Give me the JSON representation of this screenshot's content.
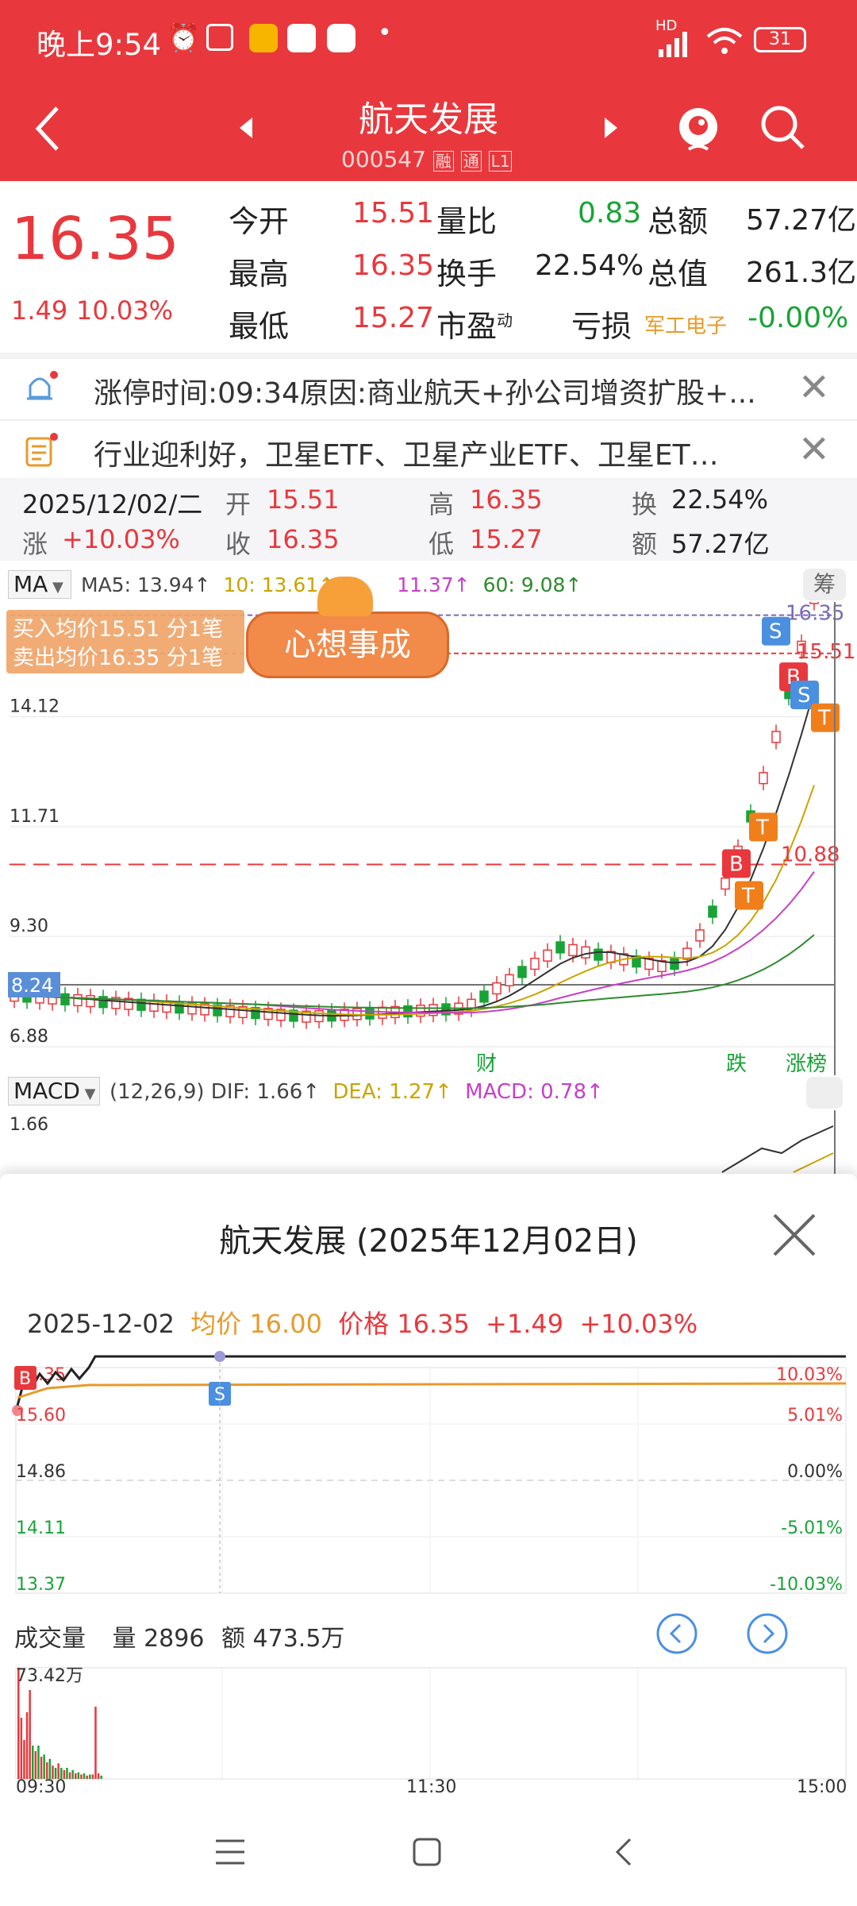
{
  "status": {
    "time": "晚上9:54",
    "signal": "HD",
    "battery": "31"
  },
  "nav": {
    "title": "航天发展",
    "code": "000547",
    "tag1": "融",
    "tag2": "通",
    "tag3": "L1"
  },
  "quote": {
    "price": "16.35",
    "change": "1.49",
    "change_pct": "10.03%",
    "open_label": "今开",
    "open": "15.51",
    "high_label": "最高",
    "high": "16.35",
    "low_label": "最低",
    "low": "15.27",
    "vol_ratio_label": "量比",
    "vol_ratio": "0.83",
    "turnover_label": "换手",
    "turnover": "22.54%",
    "pe_label": "市盈",
    "pe_sup": "动",
    "pe": "亏损",
    "amount_label": "总额",
    "amount": "57.27亿",
    "mktcap_label": "总值",
    "mktcap": "261.3亿",
    "sector": "军工电子",
    "sector_pct": "-0.00%"
  },
  "notices": [
    {
      "text": "涨停时间:09:34原因:商业航天+孙公司增资扩股+..."
    },
    {
      "text": "行业迎利好，卫星ETF、卫星产业ETF、卫星ET…"
    }
  ],
  "dayinfo": {
    "date": "2025/12/02/二",
    "open_l": "开",
    "open": "15.51",
    "high_l": "高",
    "high": "16.35",
    "turn_l": "换",
    "turn": "22.54%",
    "chg_l": "涨",
    "chg": "+10.03%",
    "close_l": "收",
    "close": "16.35",
    "low_l": "低",
    "low": "15.27",
    "amt_l": "额",
    "amt": "57.27亿"
  },
  "kline": {
    "ma_btn": "MA",
    "ma5": "MA5: 13.94↑",
    "ma10": "10: 13.61↑",
    "ma20": "11.37↑",
    "ma60": "60: 9.08↑",
    "chip_btn": "筹",
    "buy_note": "买入均价15.51 分1笔",
    "sell_note": "卖出均价16.35 分1笔",
    "banner": "心想事成",
    "y_labels": [
      "14.12",
      "11.71",
      "9.30",
      "6.88"
    ],
    "current_label": "8.24",
    "top_price": "16.35",
    "top_price2": "15.51",
    "low_mark": "10.88",
    "marker_cai": "财",
    "marker_die": "跌",
    "marker_zb": "涨榜",
    "colors": {
      "up": "#e8383d",
      "down": "#19a337",
      "ma5": "#333333",
      "ma10": "#c9a400",
      "ma20": "#c83fc8",
      "ma60": "#2e8b2e"
    }
  },
  "macd": {
    "btn": "MACD",
    "params": "(12,26,9)",
    "dif": "DIF: 1.66↑",
    "dea": "DEA: 1.27↑",
    "macd": "MACD: 0.78↑",
    "y_label": "1.66"
  },
  "popup": {
    "title": "航天发展 (2025年12月02日)",
    "date": "2025-12-02",
    "avg_label": "均价 16.00",
    "price_label": "价格 16.35",
    "chg": "+1.49",
    "chg_pct": "+10.03%",
    "left_labels": [
      "16.35",
      "15.60",
      "14.86",
      "14.11",
      "13.37"
    ],
    "right_labels": [
      "10.03%",
      "5.01%",
      "0.00%",
      "-5.01%",
      "-10.03%"
    ],
    "vol_title": "成交量",
    "vol_amount": "量 2896",
    "vol_money": "额 473.5万",
    "vol_max": "73.42万",
    "times": [
      "09:30",
      "11:30",
      "15:00"
    ]
  }
}
